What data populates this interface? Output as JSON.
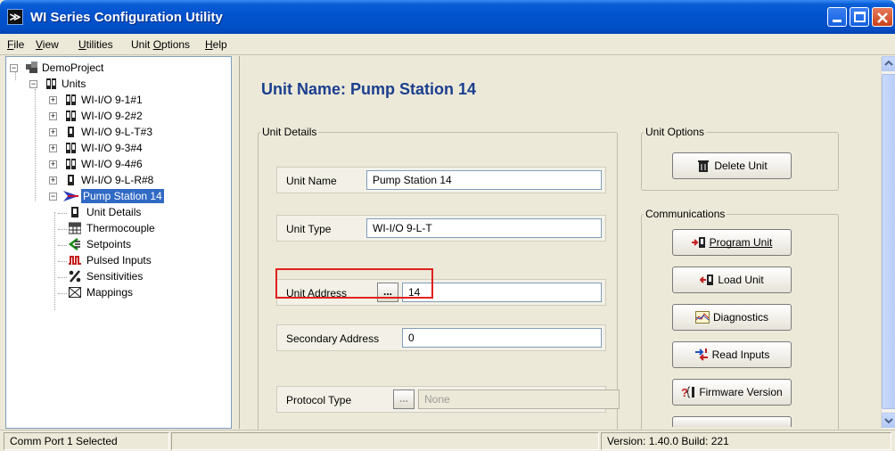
{
  "window": {
    "title": "WI Series Configuration Utility",
    "app_icon": "app-icon"
  },
  "menu": [
    {
      "label": "File",
      "accel": "F"
    },
    {
      "label": "View",
      "accel": "V"
    },
    {
      "label": "Utilities",
      "accel": "U"
    },
    {
      "label": "Unit Options",
      "accel": "O"
    },
    {
      "label": "Help",
      "accel": "H"
    }
  ],
  "tree": {
    "project": "DemoProject",
    "units_label": "Units",
    "units": [
      "WI-I/O 9-1#1",
      "WI-I/O 9-2#2",
      "WI-I/O 9-L-T#3",
      "WI-I/O 9-3#4",
      "WI-I/O 9-4#6",
      "WI-I/O 9-L-R#8"
    ],
    "selected_unit": "Pump Station 14",
    "children": [
      "Unit Details",
      "Thermocouple",
      "Setpoints",
      "Pulsed Inputs",
      "Sensitivities",
      "Mappings"
    ]
  },
  "main": {
    "title": "Unit Name: Pump Station 14",
    "unit_details_group": "Unit Details",
    "fields": {
      "unit_name": {
        "label": "Unit Name",
        "value": "Pump Station 14"
      },
      "unit_type": {
        "label": "Unit Type",
        "value": "WI-I/O 9-L-T"
      },
      "unit_address": {
        "label": "Unit Address",
        "button": "...",
        "value": "14"
      },
      "secondary_address": {
        "label": "Secondary Address",
        "value": "0"
      },
      "protocol_type": {
        "label": "Protocol Type",
        "button": "...",
        "value": "None"
      }
    },
    "unit_options_group": "Unit Options",
    "delete_unit": "Delete Unit",
    "communications_group": "Communications",
    "buttons": {
      "program_unit": "Program Unit",
      "load_unit": "Load Unit",
      "diagnostics": "Diagnostics",
      "read_inputs": "Read Inputs",
      "firmware_version": "Firmware Version"
    }
  },
  "status": {
    "left": "Comm Port 1 Selected",
    "middle": "",
    "right": "Version: 1.40.0 Build: 221"
  },
  "colors": {
    "title_bar": "#0353d0",
    "selection": "#316ac5",
    "heading": "#1b3f8f",
    "highlight_box": "#e0211d"
  }
}
